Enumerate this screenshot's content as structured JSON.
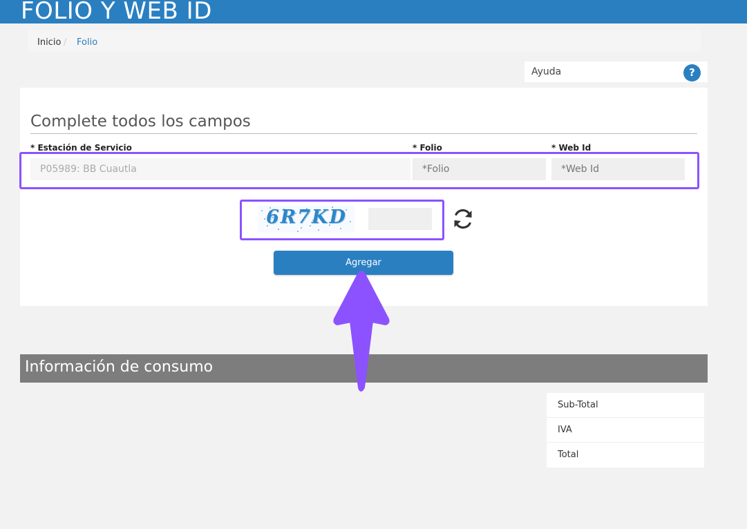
{
  "header": {
    "title": "FOLIO Y WEB ID"
  },
  "breadcrumb": {
    "home": "Inicio",
    "separator": "/",
    "current": "Folio"
  },
  "help": {
    "label": "Ayuda",
    "icon_glyph": "?"
  },
  "form": {
    "heading": "Complete todos los campos",
    "station": {
      "label": "* Estación de Servicio",
      "value": "P05989: BB Cuautla"
    },
    "folio": {
      "label": "* Folio",
      "placeholder": "*Folio"
    },
    "webid": {
      "label": "* Web Id",
      "placeholder": "*Web Id"
    },
    "captcha": {
      "text": "6R7KD",
      "input_value": ""
    },
    "submit_label": "Agregar"
  },
  "consumption": {
    "title": "Información de consumo",
    "rows": [
      "Sub-Total",
      "IVA",
      "Total"
    ]
  },
  "colors": {
    "header_bg": "#2a7fc1",
    "accent": "#2a7fc1",
    "highlight": "#8c52ff",
    "section_bar": "#7d7d7d"
  },
  "icons": [
    "help-icon",
    "refresh-icon",
    "arrow-up-annotation"
  ]
}
